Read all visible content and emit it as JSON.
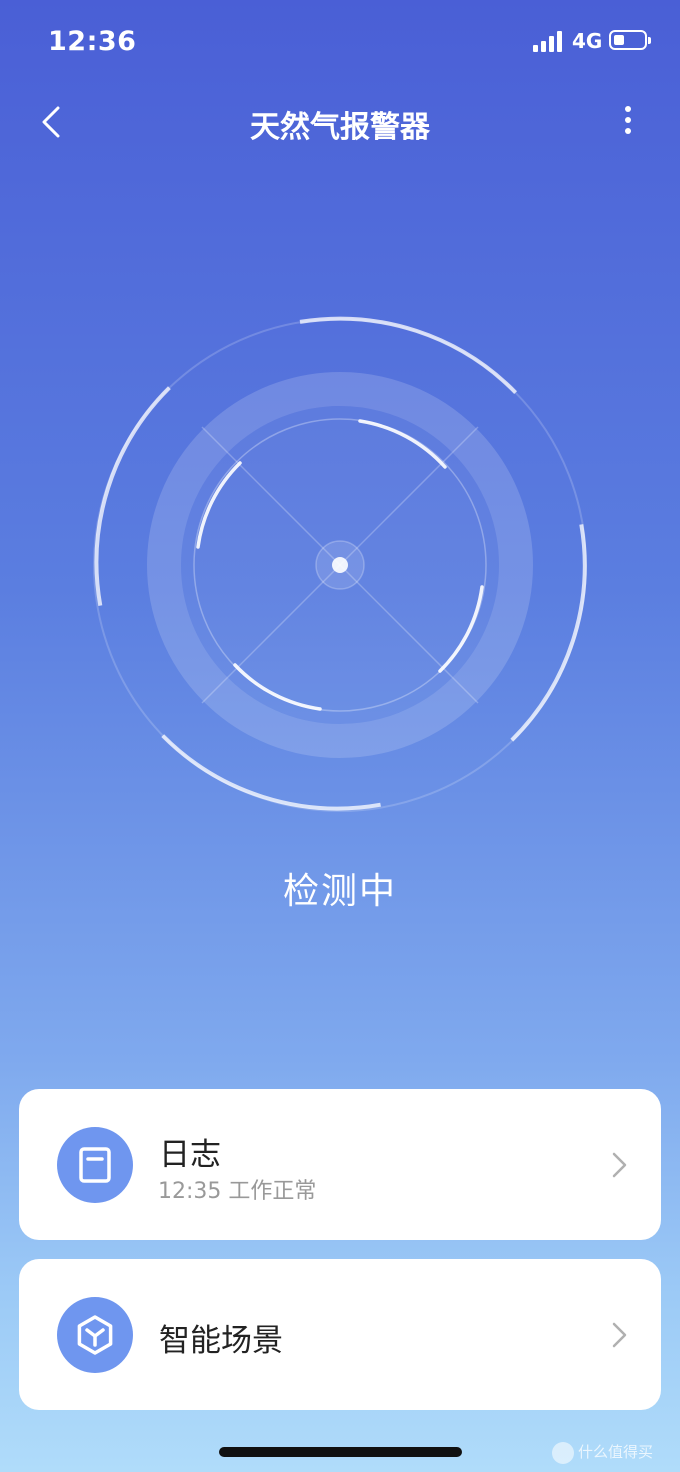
{
  "status_bar": {
    "time": "12:36",
    "network": "4G"
  },
  "nav": {
    "title": "天然气报警器",
    "back_icon": "chevron-left-icon",
    "more_icon": "more-vertical-icon"
  },
  "detector": {
    "status": "检测中"
  },
  "cards": {
    "log": {
      "title": "日志",
      "subtitle": "12:35 工作正常",
      "icon": "log-book-icon"
    },
    "scene": {
      "title": "智能场景",
      "icon": "hexagon-scene-icon"
    }
  },
  "watermark": {
    "text": "什么值得买"
  },
  "colors": {
    "gradient_top": "#4a5fd6",
    "gradient_bottom": "#b0dcfa",
    "icon_circle": "#6f96ef",
    "card_bg": "#ffffff"
  }
}
